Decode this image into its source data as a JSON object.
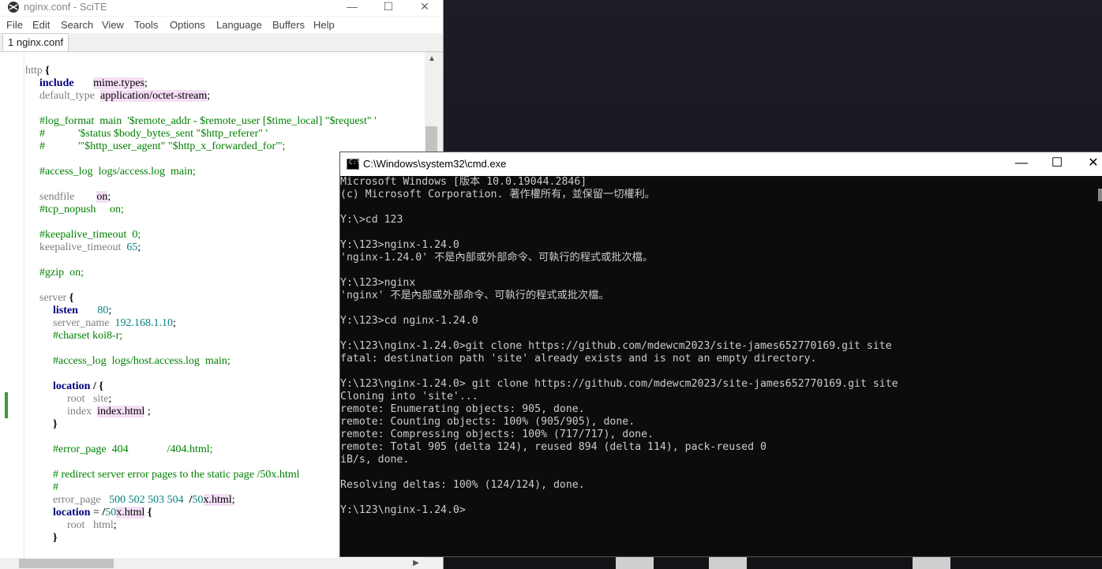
{
  "scite": {
    "title": "nginx.conf - SciTE",
    "menu": [
      "File",
      "Edit",
      "Search",
      "View",
      "Tools",
      "Options",
      "Language",
      "Buffers",
      "Help"
    ],
    "tab": "1 nginx.conf",
    "controls": {
      "minimize": "—",
      "maximize": "☐",
      "close": "✕"
    },
    "code": [
      "http {",
      "include mime.types;",
      "default_type application/octet-stream;",
      "",
      "#log_format main '$remote_addr - $remote_user [$time_local] \"$request\" '",
      "# '$status $body_bytes_sent \"$http_referer\" '",
      "# '\"$http_user_agent\" \"$http_x_forwarded_for\"';",
      "",
      "#access_log logs/access.log main;",
      "",
      "sendfile on;",
      "#tcp_nopush on;",
      "",
      "#keepalive_timeout 0;",
      "keepalive_timeout 65;",
      "",
      "#gzip on;",
      "",
      "server {",
      "listen 80;",
      "server_name 192.168.1.10;",
      "#charset koi8-r;",
      "",
      "#access_log logs/host.access.log main;",
      "",
      "location / {",
      "root site;",
      "index index.html ;",
      "}",
      "",
      "#error_page 404 /404.html;",
      "",
      "# redirect server error pages to the static page /50x.html",
      "#",
      "error_page 500 502 503 504 /50x.html;",
      "location = /50x.html {",
      "root html;",
      "}"
    ]
  },
  "cmd": {
    "title": "C:\\Windows\\system32\\cmd.exe",
    "controls": {
      "minimize": "—",
      "maximize": "☐",
      "close": "✕"
    },
    "lines": [
      "Microsoft Windows [版本 10.0.19044.2846]",
      "(c) Microsoft Corporation. 著作權所有，並保留一切權利。",
      "",
      "Y:\\>cd 123",
      "",
      "Y:\\123>nginx-1.24.0",
      "'nginx-1.24.0' 不是內部或外部命令、可執行的程式或批次檔。",
      "",
      "Y:\\123>nginx",
      "'nginx' 不是內部或外部命令、可執行的程式或批次檔。",
      "",
      "Y:\\123>cd nginx-1.24.0",
      "",
      "Y:\\123\\nginx-1.24.0>git clone https://github.com/mdewcm2023/site-james652770169.git site",
      "fatal: destination path 'site' already exists and is not an empty directory.",
      "",
      "Y:\\123\\nginx-1.24.0> git clone https://github.com/mdewcm2023/site-james652770169.git site",
      "Cloning into 'site'...",
      "remote: Enumerating objects: 905, done.",
      "remote: Counting objects: 100% (905/905), done.",
      "remote: Compressing objects: 100% (717/717), done.",
      "remote: Total 905 (delta 124), reused 894 (delta 114), pack-reused 0",
      "iB/s, done.",
      "",
      "Resolving deltas: 100% (124/124), done.",
      "",
      "Y:\\123\\nginx-1.24.0>"
    ]
  }
}
